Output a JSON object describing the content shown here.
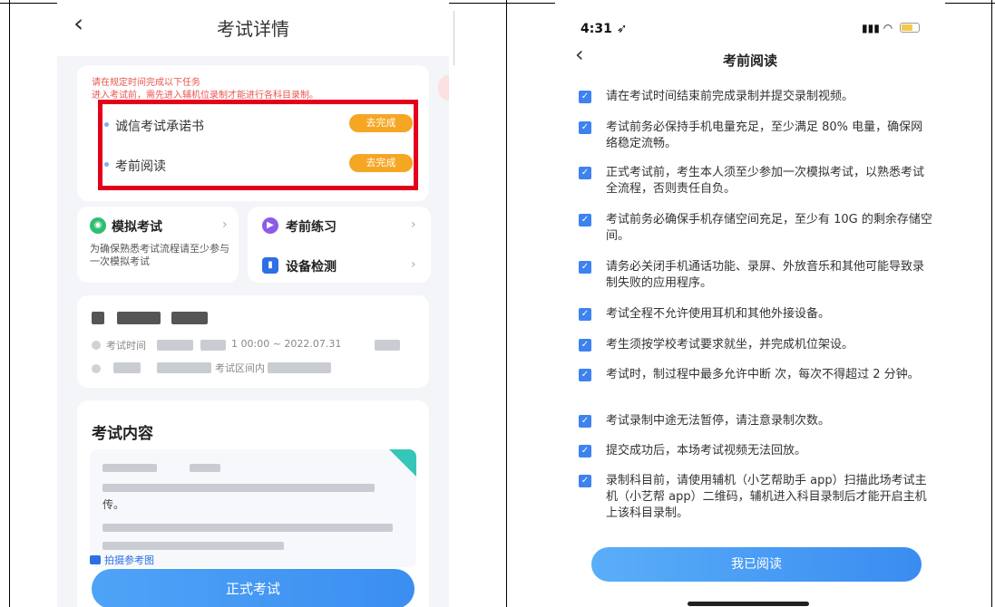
{
  "left": {
    "header": {
      "title": "考试详情"
    },
    "tasks": {
      "note_line1": "请在规定时间完成以下任务",
      "note_line2": "进入考试前，需先进入辅机位录制才能进行各科目录制。",
      "items": [
        {
          "label": "诚信考试承诺书",
          "action": "去完成"
        },
        {
          "label": "考前阅读",
          "action": "去完成"
        }
      ]
    },
    "menu": {
      "mock": {
        "title": "模拟考试",
        "desc": "为确保熟悉考试流程请至少参与一次模拟考试"
      },
      "practice": {
        "title": "考前练习"
      },
      "device": {
        "title": "设备检测"
      }
    },
    "info": {
      "time_fragment": "考试时间",
      "time_values": "1 00:00 ~ 2022.07.31 ",
      "zone_fragment": "考试区间内"
    },
    "content": {
      "title": "考试内容",
      "line_fragment": "传。",
      "photo_link": "拍摄参考图",
      "start_button": "正式考试"
    },
    "colors": {
      "red_highlight": "#e4001b",
      "orange_pill": "#f5a623",
      "blue": "#3b8ef0"
    }
  },
  "right": {
    "status": {
      "time": "4:31"
    },
    "header": {
      "title": "考前阅读"
    },
    "checklist": [
      "请在考试时间结束前完成录制并提交录制视频。",
      "考试前务必保持手机电量充足，至少满足 80% 电量，确保网络稳定流畅。",
      "正式考试前，考生本人须至少参加一次模拟考试，以熟悉考试全流程，否则责任自负。",
      "考试前务必确保手机存储空间充足，至少有 10G 的剩余存储空间。",
      "请务必关闭手机通话功能、录屏、外放音乐和其他可能导致录制失败的应用程序。",
      "考试全程不允许使用耳机和其他外接设备。",
      "考生须按学校考试要求就坐，并完成机位架设。",
      "考试时，制过程中最多允许中断 次，每次不得超过 2 分钟。",
      "考试录制中途无法暂停，请注意录制次数。",
      "提交成功后，本场考试视频无法回放。",
      "录制科目前，请使用辅机（小艺帮助手 app）扫描此场考试主机（小艺帮 app）二维码，辅机进入科目录制后才能开启主机上该科目录制。"
    ],
    "confirm_button": "我已阅读"
  }
}
